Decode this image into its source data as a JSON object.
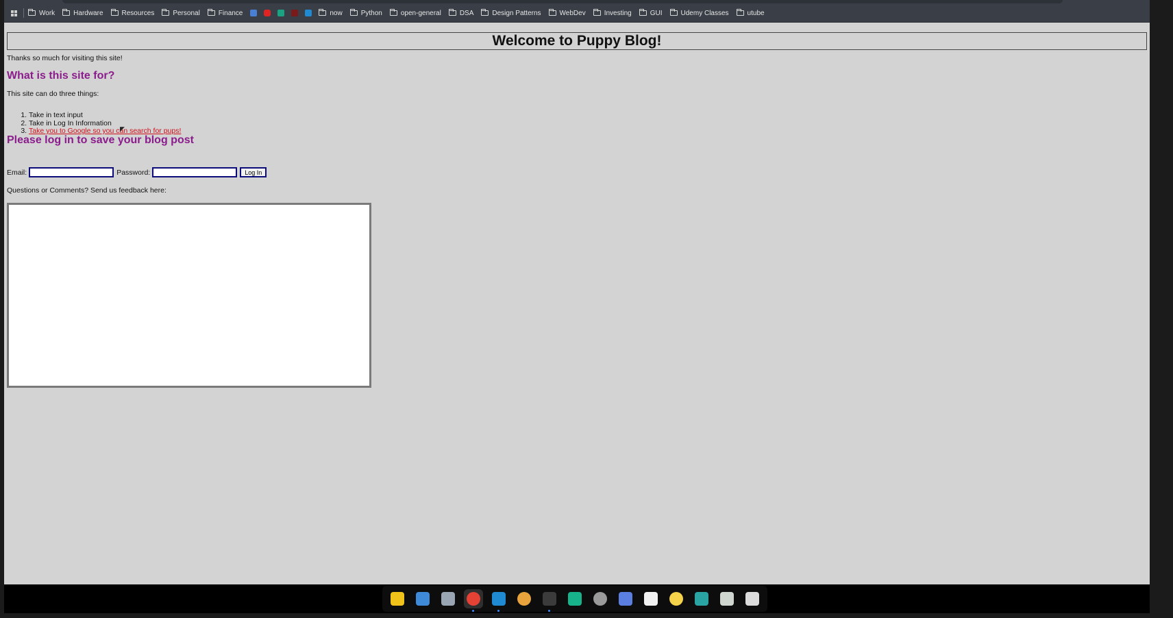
{
  "bookmarks": [
    {
      "label": "Work"
    },
    {
      "label": "Hardware"
    },
    {
      "label": "Resources"
    },
    {
      "label": "Personal"
    },
    {
      "label": "Finance"
    }
  ],
  "bookmarks_after_icons": [
    {
      "label": "now"
    },
    {
      "label": "Python"
    },
    {
      "label": "open-general"
    },
    {
      "label": "DSA"
    },
    {
      "label": "Design Patterns"
    },
    {
      "label": "WebDev"
    },
    {
      "label": "Investing"
    },
    {
      "label": "GUI"
    },
    {
      "label": "Udemy Classes"
    },
    {
      "label": "utube"
    }
  ],
  "favicons": [
    {
      "name": "translate-icon",
      "color": "#4a7fd6"
    },
    {
      "name": "youtube-icon",
      "color": "#e02424"
    },
    {
      "name": "app-green-icon",
      "color": "#1aa383"
    },
    {
      "name": "app-red-icon",
      "color": "#7a1a1a"
    },
    {
      "name": "vscode-icon",
      "color": "#1f8ad2"
    }
  ],
  "page": {
    "title": "Welcome to Puppy Blog!",
    "thanks": "Thanks so much for visiting this site!",
    "section1_heading": "What is this site for?",
    "intro": "This site can do three things:",
    "things": [
      "Take in text input",
      "Take in Log In Information",
      "Take you to Google so you can search for pups!"
    ],
    "section2_heading": "Please log in to save your blog post",
    "email_label": "Email:",
    "password_label": "Password:",
    "login_button": "Log In",
    "feedback_prompt": "Questions or Comments? Send us feedback here:"
  },
  "colors": {
    "page_bg": "#d3d3d3",
    "heading": "#8b1c8b",
    "link": "#d0101a",
    "input_border": "#0c0c7a"
  },
  "dock": [
    {
      "name": "files-manager-icon",
      "color": "#f0c21a"
    },
    {
      "name": "calendar-icon",
      "color": "#3f8ad8"
    },
    {
      "name": "file-browser-icon",
      "color": "#9aa5b3"
    },
    {
      "name": "chrome-icon",
      "color": "#e34234",
      "active": true
    },
    {
      "name": "vscode-icon",
      "color": "#1f8ad2",
      "running": true
    },
    {
      "name": "color-picker-icon",
      "color": "#e8a33d"
    },
    {
      "name": "terminal-icon",
      "color": "#3b3b3b",
      "running": true
    },
    {
      "name": "e-app-icon",
      "color": "#17b38a"
    },
    {
      "name": "settings-icon",
      "color": "#9a9a9a"
    },
    {
      "name": "tasks-icon",
      "color": "#5b7fe0"
    },
    {
      "name": "text-editor-icon",
      "color": "#f2f2f2"
    },
    {
      "name": "notes-icon",
      "color": "#f4d34a"
    },
    {
      "name": "network-icon",
      "color": "#2aa3a3"
    },
    {
      "name": "trash-icon",
      "color": "#cfd6cf"
    },
    {
      "name": "app-grid-icon",
      "color": "#dcdcdc"
    }
  ]
}
